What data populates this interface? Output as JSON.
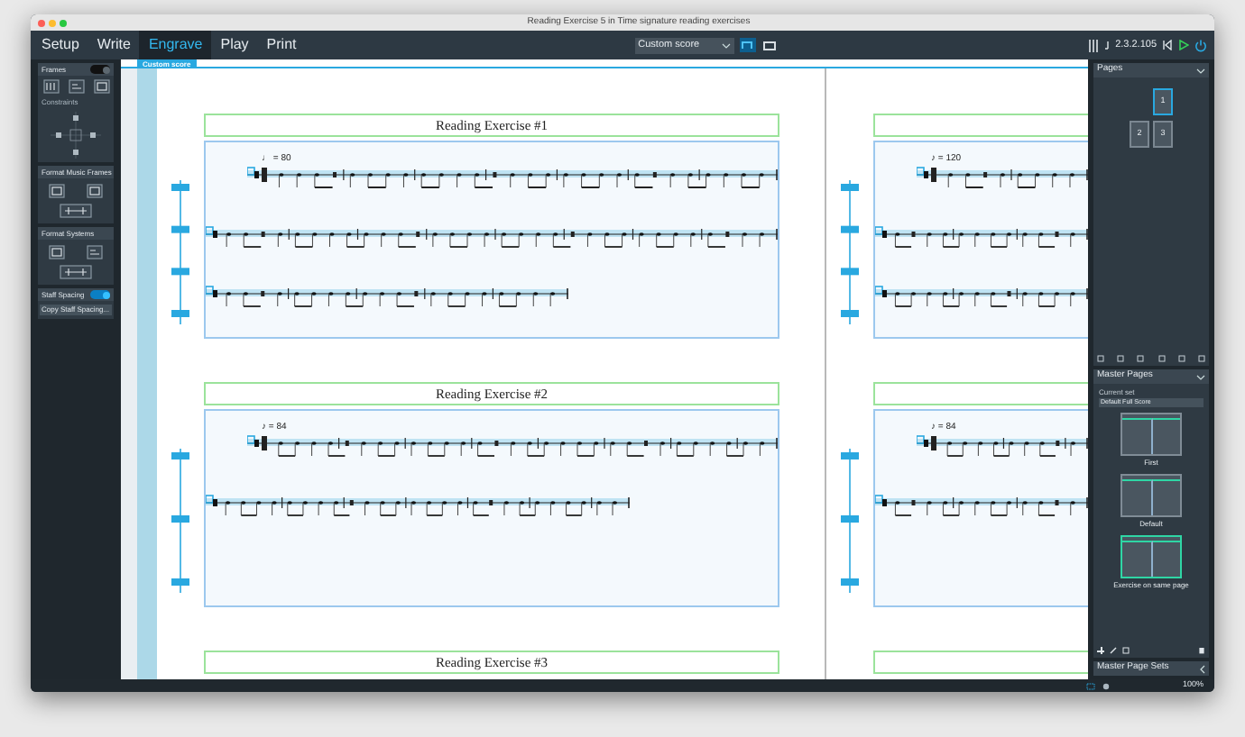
{
  "window": {
    "title": "Reading Exercise 5 in Time signature reading exercises"
  },
  "modes": [
    {
      "label": "Setup",
      "selected": false
    },
    {
      "label": "Write",
      "selected": false
    },
    {
      "label": "Engrave",
      "selected": true
    },
    {
      "label": "Play",
      "selected": false
    },
    {
      "label": "Print",
      "selected": false
    }
  ],
  "layout_selector": {
    "value": "Custom score"
  },
  "view_buttons": [
    {
      "kind": "page",
      "selected": true
    },
    {
      "kind": "galley",
      "selected": false
    }
  ],
  "version": "2.3.2.105",
  "left_panel": {
    "frames": {
      "label": "Frames",
      "on": false
    },
    "constraints_label": "Constraints",
    "sections": [
      "Format Music Frames",
      "Format Systems"
    ],
    "staff_spacing": {
      "label": "Staff Spacing",
      "on": true
    },
    "copy_button": "Copy Staff Spacing..."
  },
  "score_tab": "Custom score",
  "left_page": {
    "exercises": [
      {
        "title": "Reading Exercise #1",
        "tempo": "♩ = 80"
      },
      {
        "title": "Reading Exercise #2",
        "tempo": "♪ = 84"
      },
      {
        "title": "Reading Exercise #3"
      }
    ]
  },
  "right_page": {
    "exercises": [
      {
        "tempo": "♪ = 120"
      },
      {
        "tempo": "♪ = 84"
      }
    ]
  },
  "pages_panel": {
    "title": "Pages",
    "pages": [
      {
        "label": "1",
        "selected": true
      },
      {
        "label": "2",
        "selected": false
      },
      {
        "label": "3",
        "selected": false
      }
    ]
  },
  "master_pages": {
    "title": "Master Pages",
    "current_set_label": "Current set",
    "current_set": "Default Full Score",
    "items": [
      {
        "label": "First",
        "selected": false
      },
      {
        "label": "Default",
        "selected": false
      },
      {
        "label": "Exercise on same page",
        "selected": true
      }
    ]
  },
  "master_page_sets": {
    "title": "Master Page Sets"
  },
  "status_bar": {
    "zoom": "100%"
  }
}
